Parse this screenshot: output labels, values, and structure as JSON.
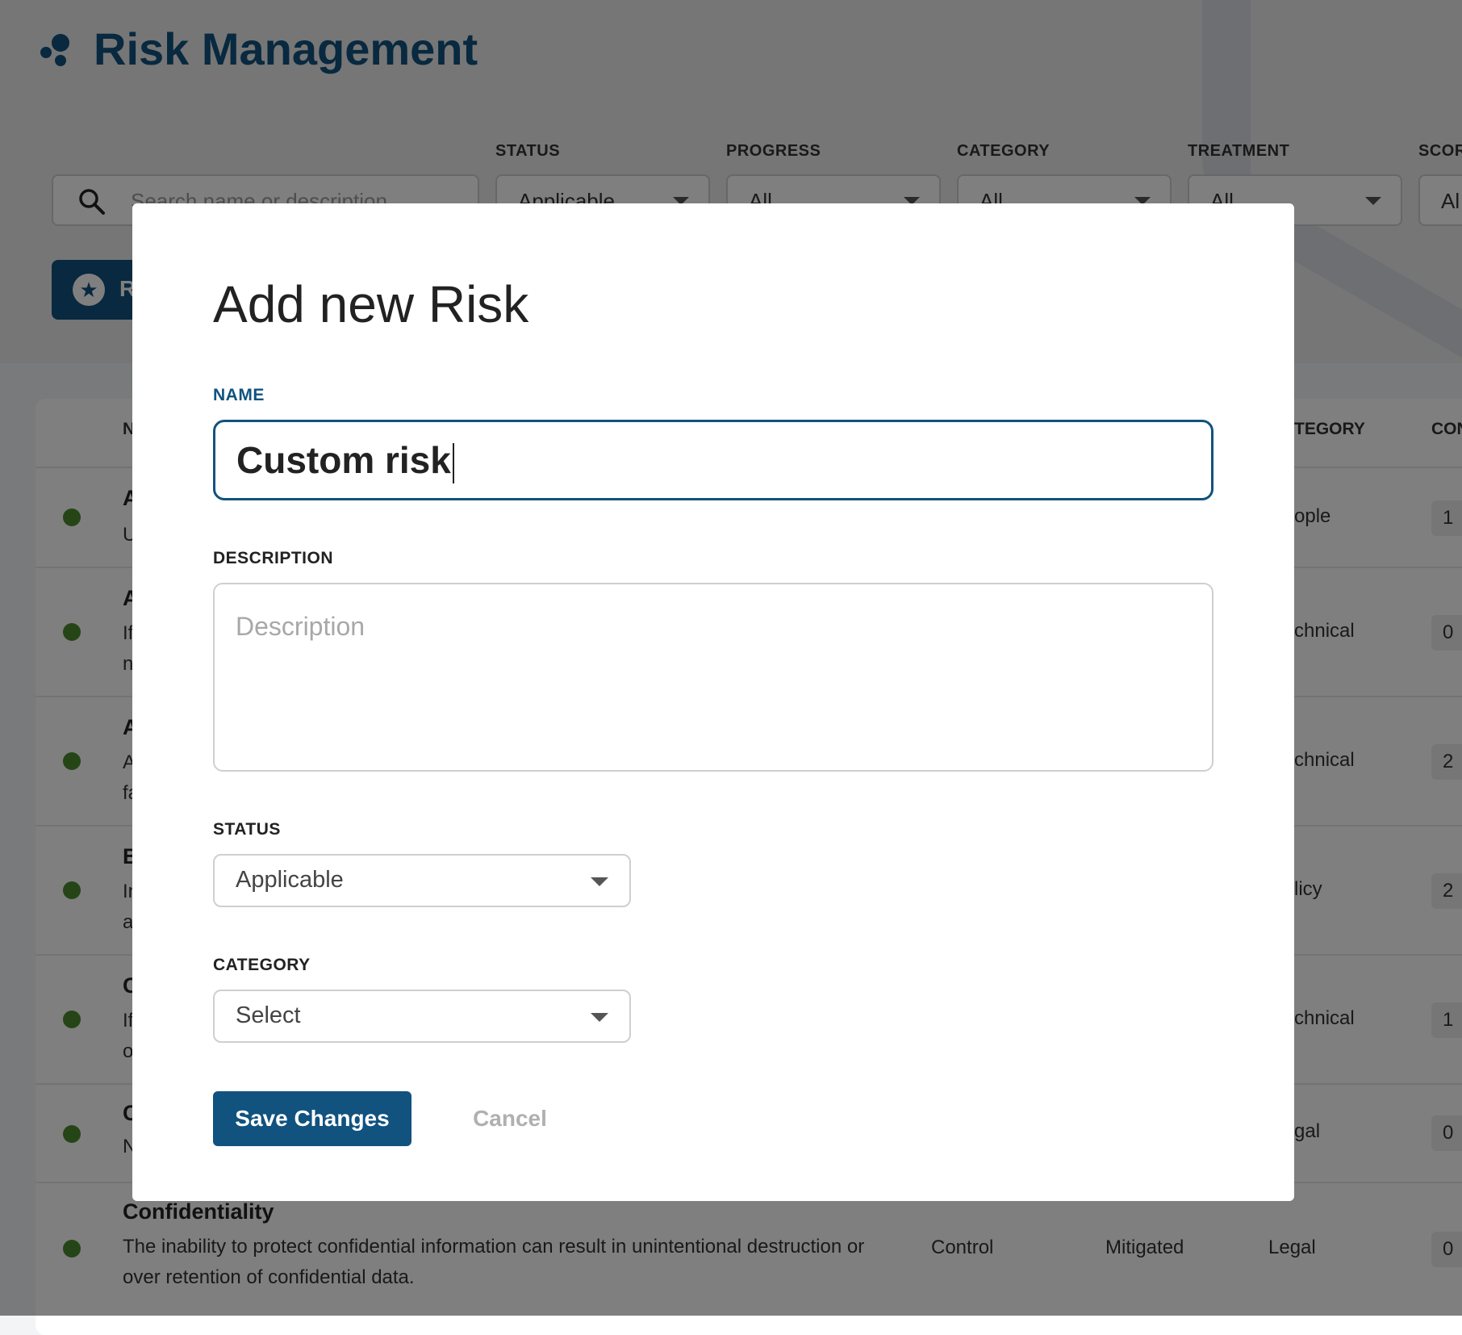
{
  "header": {
    "title": "Risk Management"
  },
  "filters": {
    "search_placeholder": "Search name or description",
    "status": {
      "label": "STATUS",
      "value": "Applicable"
    },
    "progress": {
      "label": "PROGRESS",
      "value": "All"
    },
    "category": {
      "label": "CATEGORY",
      "value": "All"
    },
    "treatment": {
      "label": "TREATMENT",
      "value": "All"
    },
    "score": {
      "label": "SCOR",
      "value": "Al"
    }
  },
  "toolbar": {
    "button_label": "R"
  },
  "table": {
    "headers": {
      "name": "N",
      "category": "TEGORY",
      "controls": "CON"
    },
    "rows": [
      {
        "name": "A",
        "desc": "U",
        "category": "ople",
        "count": "1"
      },
      {
        "name": "A",
        "desc": "If\nn",
        "category": "chnical",
        "count": "0"
      },
      {
        "name": "A",
        "desc": "A\nfa",
        "category": "chnical",
        "count": "2"
      },
      {
        "name": "B",
        "desc": "In\na",
        "category": "licy",
        "count": "2"
      },
      {
        "name": "C",
        "desc": "If\no",
        "category": "chnical",
        "count": "1"
      },
      {
        "name": "C",
        "desc": "N",
        "category": "gal",
        "count": "0"
      },
      {
        "name": "Confidentiality",
        "desc": "The inability to protect confidential information can result in unintentional destruction or over retention of confidential data.",
        "progress": "Control",
        "treatment": "Mitigated",
        "category": "Legal",
        "count": "0"
      }
    ]
  },
  "modal": {
    "title": "Add new Risk",
    "name_label": "NAME",
    "name_value": "Custom risk",
    "description_label": "DESCRIPTION",
    "description_placeholder": "Description",
    "status_label": "STATUS",
    "status_value": "Applicable",
    "category_label": "CATEGORY",
    "category_value": "Select",
    "save_label": "Save Changes",
    "cancel_label": "Cancel"
  }
}
